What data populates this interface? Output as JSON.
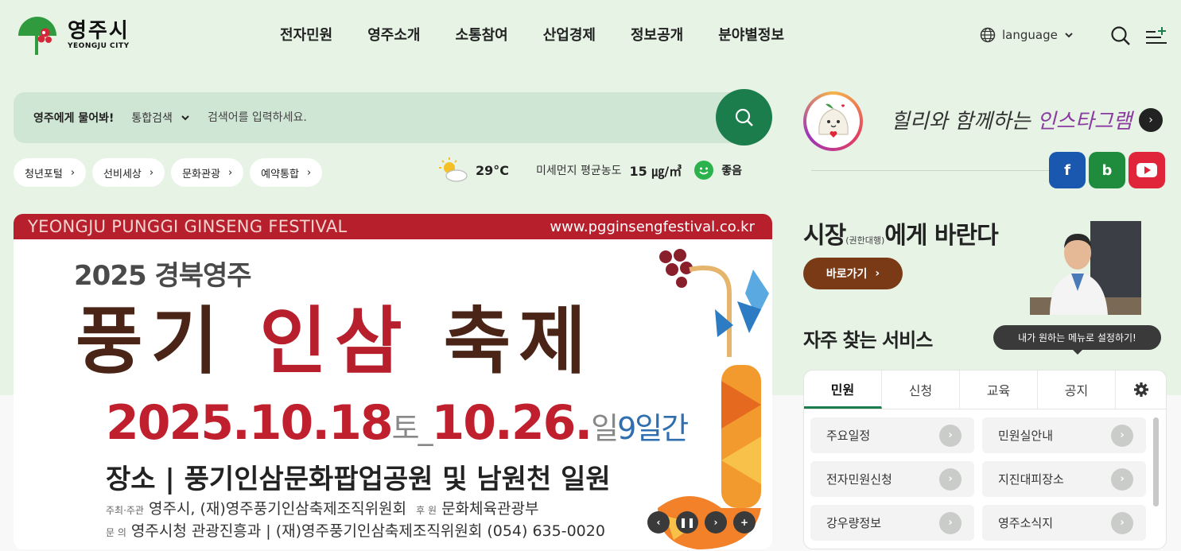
{
  "header": {
    "logo_ko": "영주시",
    "logo_en": "YEONGJU CITY",
    "nav": [
      "전자민원",
      "영주소개",
      "소통참여",
      "산업경제",
      "정보공개",
      "분야별정보"
    ],
    "language_label": "language"
  },
  "search": {
    "ask_label": "영주에게 물어봐!",
    "type_label": "통합검색",
    "placeholder": "검색어를 입력하세요."
  },
  "quick_links": [
    "청년포털",
    "선비세상",
    "문화관광",
    "예약통합"
  ],
  "weather": {
    "temperature": "29°C",
    "dust_label": "미세먼지 평균농도",
    "dust_value": "15 ㎍/㎥",
    "dust_status": "좋음"
  },
  "banner": {
    "top_left": "YEONGJU PUNGGI GINSENG FESTIVAL",
    "top_right": "www.pgginsengfestival.co.kr",
    "year_title": "2025 경북영주",
    "title_a": "풍기 ",
    "title_b": "인삼",
    "title_c": " 축제",
    "date_start": "2025.10.18",
    "date_start_day": "토",
    "date_sep": "_",
    "date_end": "10.26.",
    "date_end_day": "일",
    "date_span": "9일간",
    "venue": "장소 | 풍기인삼문화팝업공원 및 남원천 일원",
    "host_label": "주최·주관",
    "host": "영주시, (재)영주풍기인삼축제조직위원회",
    "sponsor_label": "후 원",
    "sponsor": "문화체육관광부",
    "contact_label": "문 의",
    "contact": "영주시청 관광진흥과 | (재)영주풍기인삼축제조직위원회 (054) 635-0020"
  },
  "instagram": {
    "text_a": "힐리와 함께하는 ",
    "text_b": "인스타그램"
  },
  "sns": {
    "facebook": "f",
    "blog": "b"
  },
  "mayor": {
    "title_a": "시장",
    "title_small": "(권한대행)",
    "title_b": "에게 바란다",
    "button": "바로가기"
  },
  "favorites": {
    "title": "자주 찾는 서비스",
    "tooltip": "내가 원하는 메뉴로 설정하기!",
    "tabs": [
      "민원",
      "신청",
      "교육",
      "공지"
    ],
    "items": [
      "주요일정",
      "민원실안내",
      "전자민원신청",
      "지진대피장소",
      "강우량정보",
      "영주소식지"
    ]
  },
  "colors": {
    "brand_green": "#1b7d4c",
    "banner_red": "#b81f2d",
    "mayor_brown": "#7a3a16",
    "facebook": "#1a58b0",
    "blog": "#1f8b3c",
    "youtube": "#e0243a"
  }
}
